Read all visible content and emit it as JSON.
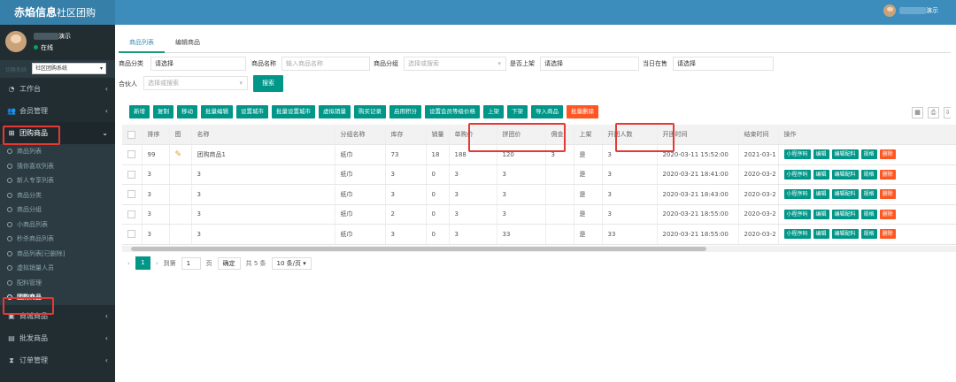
{
  "header": {
    "logo_main": "赤焰信息",
    "logo_sub": "社区团购",
    "user_name": "演示"
  },
  "sidebar": {
    "user_name": "演示",
    "status": "在线",
    "system_label": "切换系统",
    "system_select": "社区团购系统",
    "menus": [
      {
        "label": "工作台",
        "icon": "dashboard-icon",
        "chevron": "‹"
      },
      {
        "label": "会员管理",
        "icon": "users-icon",
        "chevron": "‹"
      },
      {
        "label": "团购商品",
        "icon": "sitemap-icon",
        "chevron": "⌄"
      }
    ],
    "sub_items": [
      "商品列表",
      "猜你喜欢列表",
      "新人专享列表",
      "商品分类",
      "商品分组",
      "小商品列表",
      "秒杀商品列表",
      "商品列表[已删除]",
      "虚拟销量人员",
      "配料管理",
      "团购商品"
    ],
    "menus_after": [
      {
        "label": "商城商品",
        "icon": "shop-icon",
        "chevron": "‹"
      },
      {
        "label": "批发商品",
        "icon": "briefcase-icon",
        "chevron": "‹"
      },
      {
        "label": "订单管理",
        "icon": "hourglass-icon",
        "chevron": "‹"
      }
    ]
  },
  "tabs": [
    "商品列表",
    "编辑商品"
  ],
  "filters": {
    "category_label": "商品分类",
    "category_value": "请选择",
    "name_label": "商品名称",
    "name_placeholder": "输入商品名称",
    "group_label": "商品分组",
    "group_placeholder": "选择或搜索",
    "onsale_label": "是否上架",
    "onsale_value": "请选择",
    "today_label": "当日在售",
    "today_value": "请选择",
    "partner_label": "合伙人",
    "partner_placeholder": "选择或搜索",
    "search_button": "搜索"
  },
  "toolbar": [
    "新增",
    "复制",
    "移动",
    "批量编辑",
    "设置城市",
    "批量设置城市",
    "虚拟销量",
    "购买记录",
    "启用积分",
    "设置会员等级价格",
    "上架",
    "下架",
    "导入商品"
  ],
  "toolbar_danger": "批量删除",
  "table": {
    "columns": [
      "排序",
      "图",
      "名称",
      "分组名称",
      "库存",
      "销量",
      "单购价",
      "拼团价",
      "佣金",
      "上架",
      "开团人数",
      "开团时间",
      "结束时间",
      "操作"
    ],
    "rows": [
      [
        "99",
        "✎",
        "团购商品1",
        "纸巾",
        "73",
        "18",
        "188",
        "120",
        "3",
        "是",
        "3",
        "2020-03-11 15:52:00",
        "2021-03-1"
      ],
      [
        "3",
        "",
        "3",
        "纸巾",
        "3",
        "0",
        "3",
        "3",
        "",
        "是",
        "3",
        "2020-03-21 18:41:00",
        "2020-03-2"
      ],
      [
        "3",
        "",
        "3",
        "纸巾",
        "3",
        "0",
        "3",
        "3",
        "",
        "是",
        "3",
        "2020-03-21 18:43:00",
        "2020-03-2"
      ],
      [
        "3",
        "",
        "3",
        "纸巾",
        "2",
        "0",
        "3",
        "3",
        "",
        "是",
        "3",
        "2020-03-21 18:55:00",
        "2020-03-2"
      ],
      [
        "3",
        "",
        "3",
        "纸巾",
        "3",
        "0",
        "3",
        "33",
        "",
        "是",
        "33",
        "2020-03-21 18:55:00",
        "2020-03-2"
      ]
    ],
    "row_actions": [
      "小程序码",
      "编辑",
      "编辑配料",
      "规格",
      "删除"
    ]
  },
  "pager": {
    "current": "1",
    "goto_label": "到第",
    "goto_value": "1",
    "page_unit": "页",
    "confirm": "确定",
    "total": "共 5 条",
    "per_page": "10 条/页"
  },
  "colors": {
    "primary": "#009688",
    "danger": "#ff5722",
    "header": "#3c8dbc",
    "sidebar": "#222d32",
    "highlight": "#e53935"
  }
}
